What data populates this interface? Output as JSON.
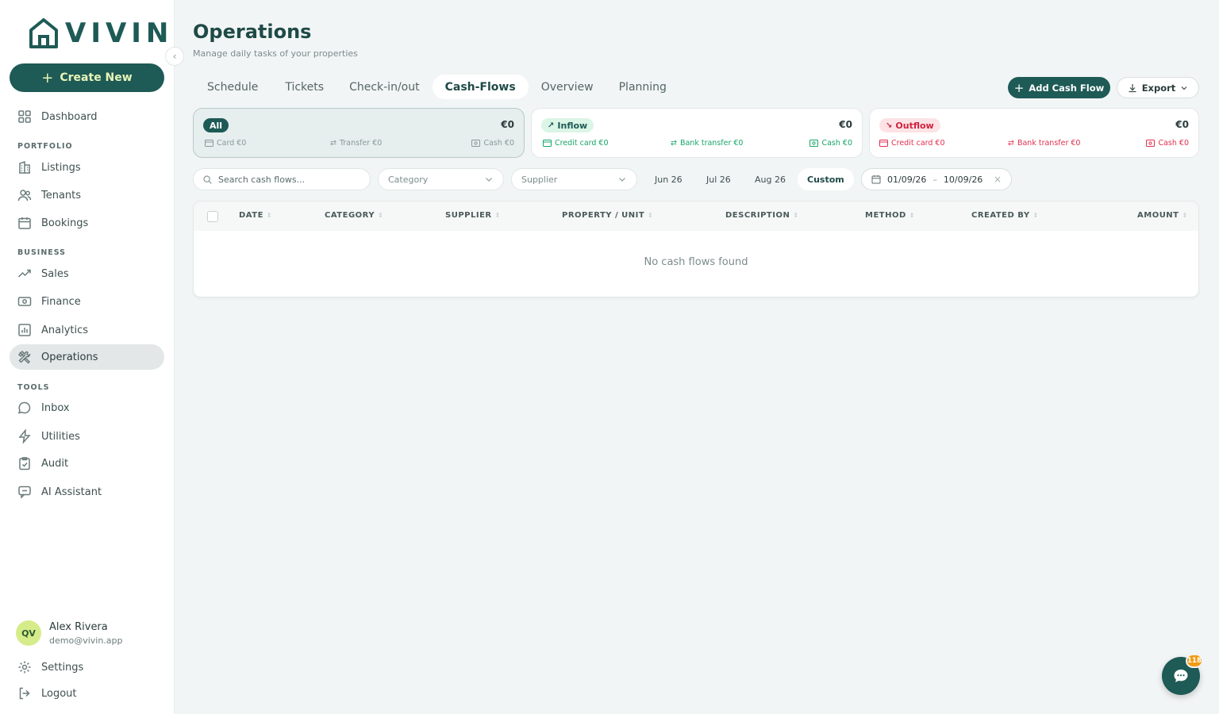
{
  "brand": {
    "name": "VIVIN"
  },
  "sidebar": {
    "create_label": "Create New",
    "dashboard": "Dashboard",
    "sections": {
      "portfolio": "PORTFOLIO",
      "business": "BUSINESS",
      "tools": "TOOLS"
    },
    "portfolio_items": [
      "Listings",
      "Tenants",
      "Bookings"
    ],
    "business_items": [
      "Sales",
      "Finance",
      "Analytics",
      "Operations"
    ],
    "tools_items": [
      "Inbox",
      "Utilities",
      "Audit",
      "AI Assistant"
    ],
    "user": {
      "initials": "QV",
      "name": "Alex Rivera",
      "email": "demo@vivin.app"
    },
    "settings": "Settings",
    "logout": "Logout"
  },
  "page": {
    "title": "Operations",
    "subtitle": "Manage daily tasks of your properties"
  },
  "tabs": [
    "Schedule",
    "Tickets",
    "Check-in/out",
    "Cash-Flows",
    "Overview",
    "Planning"
  ],
  "actions": {
    "add": "Add Cash Flow",
    "export": "Export"
  },
  "summary": {
    "all": {
      "badge": "All",
      "total": "€0",
      "card": "Card €0",
      "transfer": "Transfer €0",
      "cash": "Cash €0"
    },
    "inflow": {
      "badge": "Inflow",
      "total": "€0",
      "credit": "Credit card  €0",
      "bank": "Bank transfer  €0",
      "cash": "Cash  €0"
    },
    "outflow": {
      "badge": "Outflow",
      "total": "€0",
      "credit": "Credit card  €0",
      "bank": "Bank transfer  €0",
      "cash": "Cash  €0"
    }
  },
  "filters": {
    "search_placeholder": "Search cash flows...",
    "category": "Category",
    "supplier": "Supplier",
    "periods": [
      "Jun 26",
      "Jul 26",
      "Aug 26",
      "Custom"
    ],
    "date_from": "01/09/26",
    "date_sep": "–",
    "date_to": "10/09/26"
  },
  "table": {
    "columns": [
      "DATE",
      "CATEGORY",
      "SUPPLIER",
      "PROPERTY / UNIT",
      "DESCRIPTION",
      "METHOD",
      "CREATED BY",
      "AMOUNT"
    ],
    "empty": "No cash flows found"
  },
  "chat": {
    "badge": "118"
  },
  "colors": {
    "brand": "#1e5a56",
    "accent": "#d6ec8a",
    "inflow": "#17a567",
    "outflow": "#e0304e"
  }
}
